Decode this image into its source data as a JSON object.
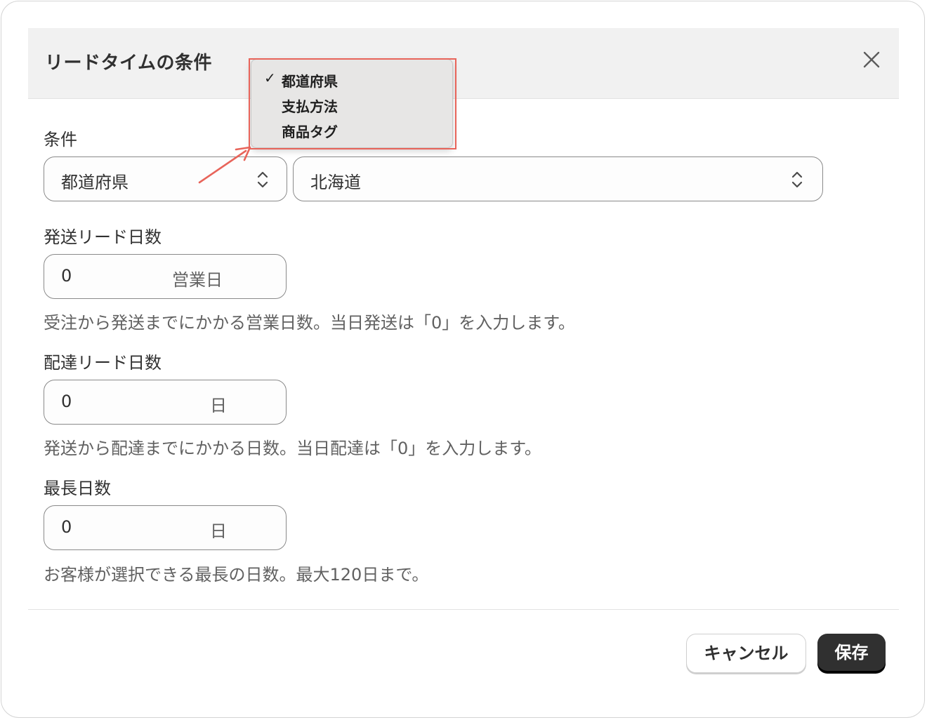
{
  "modal": {
    "title": "リードタイムの条件",
    "close_icon": "close-icon"
  },
  "condition": {
    "label": "条件",
    "type_select_value": "都道府県",
    "value_select_value": "北海道"
  },
  "dropdown": {
    "options": [
      {
        "label": "都道府県",
        "checked": true
      },
      {
        "label": "支払方法",
        "checked": false
      },
      {
        "label": "商品タグ",
        "checked": false
      }
    ],
    "check_glyph": "✓",
    "highlight_color": "#e8645a"
  },
  "shipping_lead": {
    "label": "発送リード日数",
    "value": "0",
    "suffix": "営業日",
    "help": "受注から発送までにかかる営業日数。当日発送は「0」を入力します。"
  },
  "delivery_lead": {
    "label": "配達リード日数",
    "value": "0",
    "suffix": "日",
    "help": "発送から配達までにかかる日数。当日配達は「0」を入力します。"
  },
  "max_days": {
    "label": "最長日数",
    "value": "0",
    "suffix": "日",
    "help": "お客様が選択できる最長の日数。最大120日まで。"
  },
  "footer": {
    "cancel_label": "キャンセル",
    "save_label": "保存"
  },
  "colors": {
    "primary_button": "#303030",
    "header_bg": "#f1f1f1",
    "annotation": "#e8645a"
  }
}
